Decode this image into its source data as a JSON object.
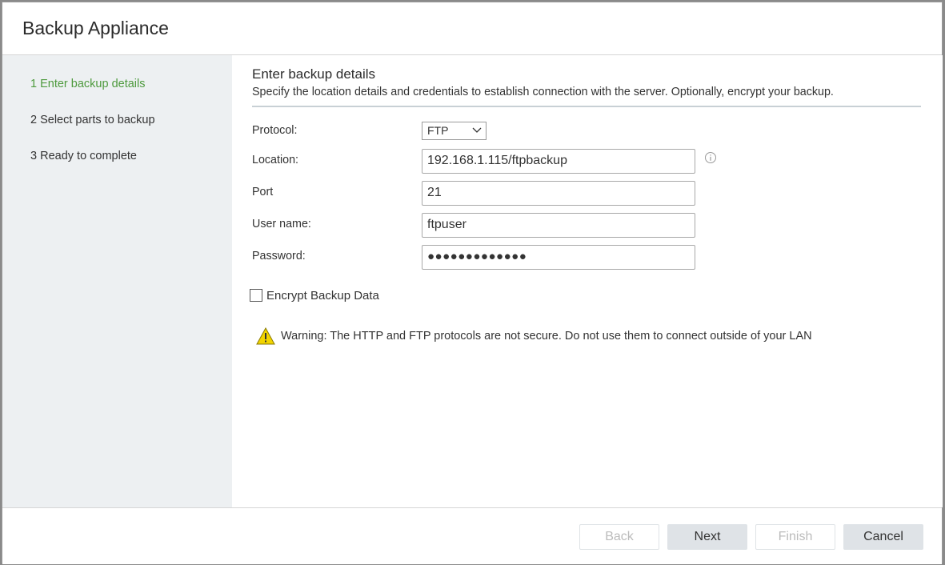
{
  "window": {
    "title": "Backup Appliance"
  },
  "steps": [
    {
      "label": "1 Enter backup details",
      "active": true
    },
    {
      "label": "2 Select parts to backup",
      "active": false
    },
    {
      "label": "3 Ready to complete",
      "active": false
    }
  ],
  "main": {
    "heading": "Enter backup details",
    "subheading": "Specify the location details and credentials to establish connection with the server. Optionally, encrypt your backup."
  },
  "form": {
    "protocol_label": "Protocol:",
    "protocol_value": "FTP",
    "location_label": "Location:",
    "location_value": "192.168.1.115/ftpbackup",
    "port_label": "Port",
    "port_value": "21",
    "username_label": "User name:",
    "username_value": "ftpuser",
    "password_label": "Password:",
    "password_value": "●●●●●●●●●●●●●"
  },
  "encrypt": {
    "label": "Encrypt Backup Data",
    "checked": false
  },
  "warning": {
    "text": "Warning: The HTTP and FTP protocols are not secure. Do not use them to connect outside of your LAN"
  },
  "footer": {
    "back_label": "Back",
    "next_label": "Next",
    "finish_label": "Finish",
    "cancel_label": "Cancel"
  },
  "colors": {
    "active_step": "#4e9a3e",
    "sidebar_bg": "#edf0f2",
    "button_bg": "#dfe3e7",
    "warning_yellow": "#f2d400"
  }
}
